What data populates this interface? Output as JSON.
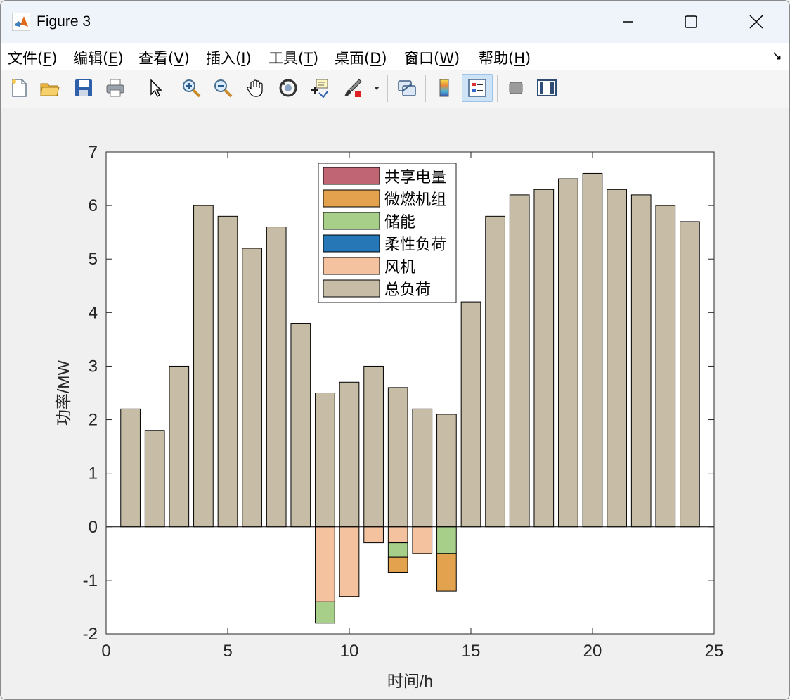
{
  "window": {
    "title": "Figure 3"
  },
  "menu": [
    {
      "label": "文件(",
      "key": "F",
      "tail": ")"
    },
    {
      "label": "编辑(",
      "key": "E",
      "tail": ")"
    },
    {
      "label": "查看(",
      "key": "V",
      "tail": ")"
    },
    {
      "label": "插入(",
      "key": "I",
      "tail": ")"
    },
    {
      "label": "工具(",
      "key": "T",
      "tail": ")"
    },
    {
      "label": "桌面(",
      "key": "D",
      "tail": ")"
    },
    {
      "label": "窗口(",
      "key": "W",
      "tail": ")"
    },
    {
      "label": "帮助(",
      "key": "H",
      "tail": ")"
    }
  ],
  "toolbar": {
    "icons": [
      "new-figure-icon",
      "open-file-icon",
      "save-icon",
      "print-icon",
      "edit-plot-icon",
      "zoom-in-icon",
      "zoom-out-icon",
      "pan-icon",
      "rotate-3d-icon",
      "data-cursor-icon",
      "brush-icon",
      "brush-menu-icon",
      "link-plot-icon",
      "colorbar-icon",
      "legend-icon",
      "hide-plot-tools-icon",
      "show-plot-tools-icon"
    ]
  },
  "colors": {
    "shared": "#c06574",
    "micro_turbine": "#e3a24e",
    "storage": "#a8cf8a",
    "flexible_load": "#2577b5",
    "wind": "#f5c29f",
    "total_load": "#c7bda6"
  },
  "chart_data": {
    "type": "bar",
    "stacked": true,
    "xlabel": "时间/h",
    "ylabel": "功率/MW",
    "xlim": [
      0,
      25
    ],
    "ylim": [
      -2,
      7
    ],
    "xticks": [
      0,
      5,
      10,
      15,
      20,
      25
    ],
    "yticks": [
      -2,
      -1,
      0,
      1,
      2,
      3,
      4,
      5,
      6,
      7
    ],
    "legend_position": "top-center",
    "x": [
      1,
      2,
      3,
      4,
      5,
      6,
      7,
      8,
      9,
      10,
      11,
      12,
      13,
      14,
      15,
      16,
      17,
      18,
      19,
      20,
      21,
      22,
      23,
      24
    ],
    "series": [
      {
        "name": "共享电量",
        "color": "#c06574",
        "values": [
          0,
          0,
          0,
          0,
          0,
          0,
          0,
          0,
          0,
          0,
          0,
          0,
          0,
          0,
          0,
          0,
          0,
          0,
          0,
          0,
          0,
          0,
          0,
          0
        ]
      },
      {
        "name": "微燃机组",
        "color": "#e3a24e",
        "values": [
          0,
          0,
          0,
          0,
          0,
          0,
          0,
          0,
          0,
          0,
          0,
          -0.28,
          0,
          -0.7,
          0,
          0,
          0,
          0,
          0,
          0,
          0,
          0,
          0,
          0
        ]
      },
      {
        "name": "储能",
        "color": "#a8cf8a",
        "values": [
          0,
          0,
          0,
          0,
          0,
          0,
          0,
          0,
          -0.4,
          0,
          0,
          -0.27,
          0,
          -0.5,
          0,
          0,
          0,
          0,
          0,
          0,
          0,
          0,
          0,
          0
        ]
      },
      {
        "name": "柔性负荷",
        "color": "#2577b5",
        "values": [
          0,
          0,
          0,
          0,
          0,
          0,
          0,
          0,
          0,
          0,
          0,
          0,
          0,
          0,
          0,
          0,
          0,
          0,
          0,
          0,
          0,
          0,
          0,
          0
        ]
      },
      {
        "name": "风机",
        "color": "#f5c29f",
        "values": [
          0,
          0,
          0,
          0,
          0,
          0,
          0,
          0,
          -1.4,
          -1.3,
          -0.3,
          -0.3,
          -0.5,
          0,
          0,
          0,
          0,
          0,
          0,
          0,
          0,
          0,
          0,
          0
        ]
      },
      {
        "name": "总负荷",
        "color": "#c7bda6",
        "values": [
          2.2,
          1.8,
          3.0,
          6.0,
          5.8,
          5.2,
          5.6,
          3.8,
          2.5,
          2.7,
          3.0,
          2.6,
          2.2,
          2.1,
          4.2,
          5.8,
          6.2,
          6.3,
          6.5,
          6.6,
          6.3,
          6.2,
          6.0,
          5.7
        ]
      }
    ],
    "stack_order_negative": [
      "风机",
      "储能",
      "微燃机组",
      "共享电量",
      "柔性负荷"
    ]
  }
}
